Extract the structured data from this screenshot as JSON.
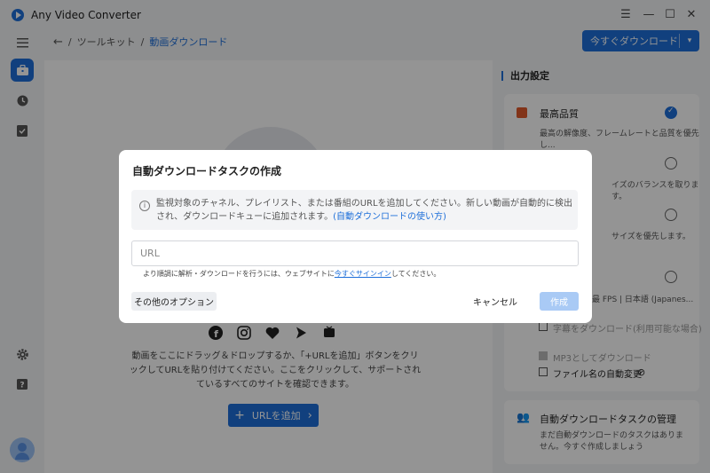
{
  "app": {
    "title": "Any Video Converter"
  },
  "window": {
    "menu_icon": "☰",
    "minimize_icon": "—",
    "maximize_icon": "☐",
    "close_icon": "✕"
  },
  "sidebar": {
    "items": [
      "menu-icon",
      "toolkit-icon",
      "history-icon",
      "task-icon",
      "settings-icon",
      "help-icon"
    ]
  },
  "breadcrumb": {
    "back": "←",
    "sep": "/",
    "root": "ツールキット",
    "current": "動画ダウンロード"
  },
  "header": {
    "download_now_label": "今すぐダウンロード",
    "dropdown_icon": "▾"
  },
  "main": {
    "drop_text": "動画をここにドラッグ＆ドロップするか、「+URLを追加」ボタンをクリックしてURLを貼り付けてください。ここをクリックして、サポートされているすべてのサイトを確認できます。",
    "url_add_label": "URLを追加",
    "url_add_plus": "+",
    "url_add_arrow": "›"
  },
  "right_panel": {
    "title": "出力設定",
    "best_quality_label": "最高品質",
    "best_quality_desc": "最高の解像度、フレームレートと品質を優先し...",
    "option2_desc": "イズのバランスを取ります。",
    "option3_desc": "サイズを優先します。",
    "option4_desc": "最 FPS | 日本語 (Japanes...",
    "subtitle_download_label": "字幕をダウンロード(利用可能な場合)",
    "mp3_label": "MP3としてダウンロード",
    "auto_rename_label": "ファイル名の自動変更",
    "auto_task_title": "自動ダウンロードタスクの管理",
    "auto_task_desc": "まだ自動ダウンロードのタスクはありません。今すぐ作成しましょう"
  },
  "dialog": {
    "title": "自動ダウンロードタスクの作成",
    "info_text": "監視対象のチャネル、プレイリスト、または番組のURLを追加してください。新しい動画が自動的に検出され、ダウンロードキューに追加されます。",
    "info_link": "(自動ダウンロードの使い方)",
    "url_placeholder": "URL",
    "url_value": "",
    "hint_prefix": "より順調に解析・ダウンロードを行うには、ウェブサイトに",
    "hint_link": "今すぐサインイン",
    "hint_suffix": "してください。",
    "other_options_label": "その他のオプション",
    "cancel_label": "キャンセル",
    "create_label": "作成"
  },
  "colors": {
    "accent": "#1e6fd9",
    "accent_disabled": "#a9caf5",
    "overlay": "rgba(0,0,0,0.42)"
  }
}
